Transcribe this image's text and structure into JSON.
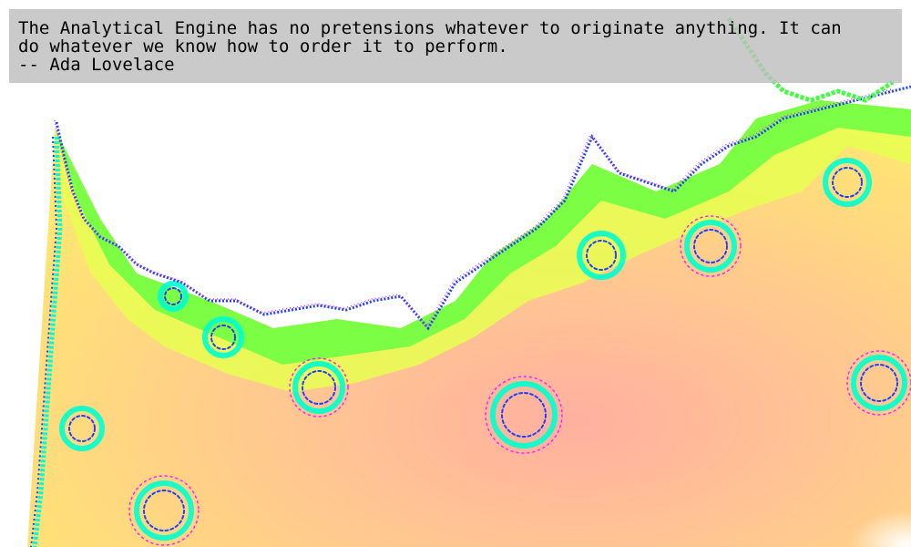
{
  "quote": {
    "lines": [
      "The Analytical Engine has no pretensions whatever to originate anything. It can",
      "do whatever we know how to order it to perform.",
      "-- Ada Lovelace"
    ]
  },
  "palette": {
    "background": "#ffffff",
    "peach": "#ffc090",
    "yellow": "#f0ff40",
    "green": "#40ff40",
    "cyan": "#00ffd0",
    "blue": "#2040ff",
    "magenta": "#ff20ff",
    "banner": "#bebebe"
  }
}
